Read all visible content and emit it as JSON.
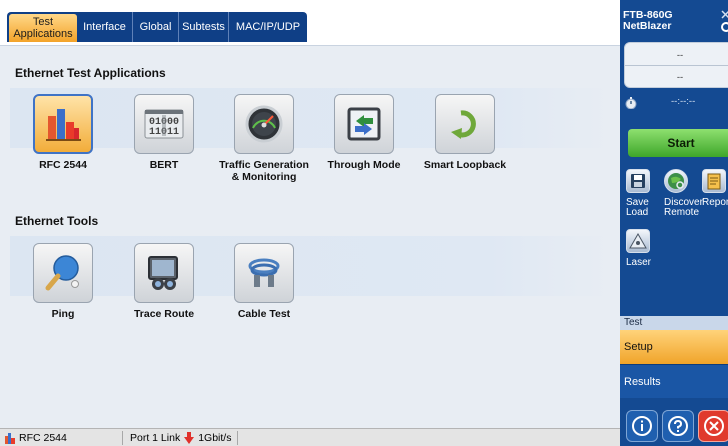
{
  "tabs": [
    {
      "label": "Test Applications",
      "active": true
    },
    {
      "label": "Interface",
      "active": false
    },
    {
      "label": "Global",
      "active": false
    },
    {
      "label": "Subtests",
      "active": false
    },
    {
      "label": "MAC/IP/UDP",
      "active": false
    }
  ],
  "sections": {
    "apps_title": "Ethernet Test Applications",
    "tools_title": "Ethernet Tools"
  },
  "apps": [
    {
      "label": "RFC 2544",
      "icon": "bar-chart-icon",
      "selected": true
    },
    {
      "label": "BERT",
      "icon": "binary-data-icon",
      "selected": false
    },
    {
      "label": "Traffic Generation & Monitoring",
      "icon": "gauge-icon",
      "selected": false
    },
    {
      "label": "Through Mode",
      "icon": "through-arrows-icon",
      "selected": false
    },
    {
      "label": "Smart Loopback",
      "icon": "loopback-arrow-icon",
      "selected": false
    }
  ],
  "tools": [
    {
      "label": "Ping",
      "icon": "ping-paddle-icon"
    },
    {
      "label": "Trace Route",
      "icon": "trace-route-icon"
    },
    {
      "label": "Cable Test",
      "icon": "cable-icon"
    }
  ],
  "statusbar": {
    "app": "RFC 2544",
    "port_label": "Port 1 Link",
    "speed": "1Gbit/s"
  },
  "device": {
    "model": "FTB-860G",
    "name": "NetBlazer"
  },
  "timer": {
    "value1": "--",
    "value2": "--",
    "clock": "--:--:--"
  },
  "controls": {
    "start": "Start",
    "save_load": [
      "Save",
      "Load"
    ],
    "discover_remote": [
      "Discover",
      "Remote"
    ],
    "report": "Report",
    "laser": "Laser"
  },
  "testnav": {
    "header": "Test",
    "items": [
      "Setup",
      "Results"
    ]
  },
  "colors": {
    "panel_blue": "#144a92",
    "tab_blue": "#0f3f86",
    "accent_orange": "#f3a329",
    "start_green": "#3ea62a",
    "link_down_red": "#e0302a",
    "close_red": "#e03a2c"
  }
}
